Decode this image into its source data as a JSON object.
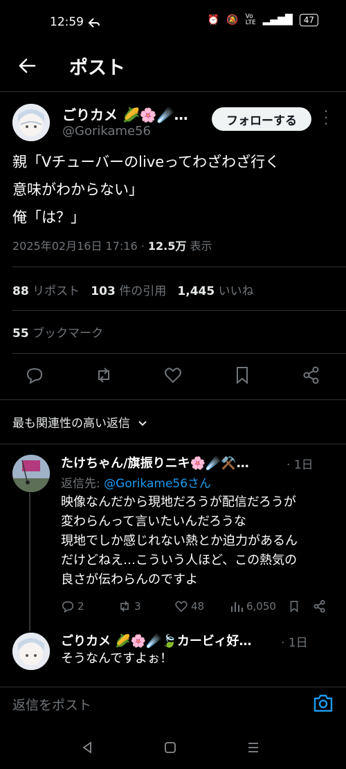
{
  "status_bar": {
    "time": "12:59",
    "battery": "47"
  },
  "header": {
    "title": "ポスト"
  },
  "post": {
    "author_name": "ごりカメ 🌽🌸☄️…",
    "author_handle": "@Gorikame56",
    "follow_label": "フォローする",
    "text_line1": "親「Vチューバーのliveってわざわざ行く",
    "text_line2": "意味がわからない」",
    "text_line3": "俺「は？」",
    "timestamp": "2025年02月16日 17:16 · ",
    "views": "12.5万",
    "views_suffix": " 表示",
    "reposts_count": "88",
    "reposts_label": " リポスト",
    "quotes_count": "103",
    "quotes_label": " 件の引用",
    "likes_count": "1,445",
    "likes_label": " いいね",
    "bookmarks_count": "55",
    "bookmarks_label": " ブックマーク"
  },
  "sort": {
    "label": "最も関連性の高い返信"
  },
  "replies": [
    {
      "author_name": "たけちゃん/旗振りニキ🌸☄️⚒️…",
      "time": "1日",
      "reply_to_prefix": "返信先: ",
      "reply_to_handle": "@Gorikame56さん",
      "line1": "映像なんだから現地だろうが配信だろうが",
      "line2": "変わらんって言いたいんだろうな",
      "line3": "現地でしか感じれない熱とか迫力があるん",
      "line4": "だけどねえ…こういう人ほど、この熱気の",
      "line5": "良さが伝わらんのですよ",
      "replies_count": "2",
      "reposts_count": "3",
      "likes_count": "48",
      "views_count": "6,050"
    },
    {
      "author_name": "ごりカメ 🌽🌸☄️🍃カービィ好…",
      "time": "1日",
      "line1": "そうなんですよぉ！"
    }
  ],
  "compose": {
    "placeholder": "返信をポスト"
  },
  "colors": {
    "accent": "#1d9bf0",
    "background": "#000000",
    "muted": "#71767b"
  }
}
